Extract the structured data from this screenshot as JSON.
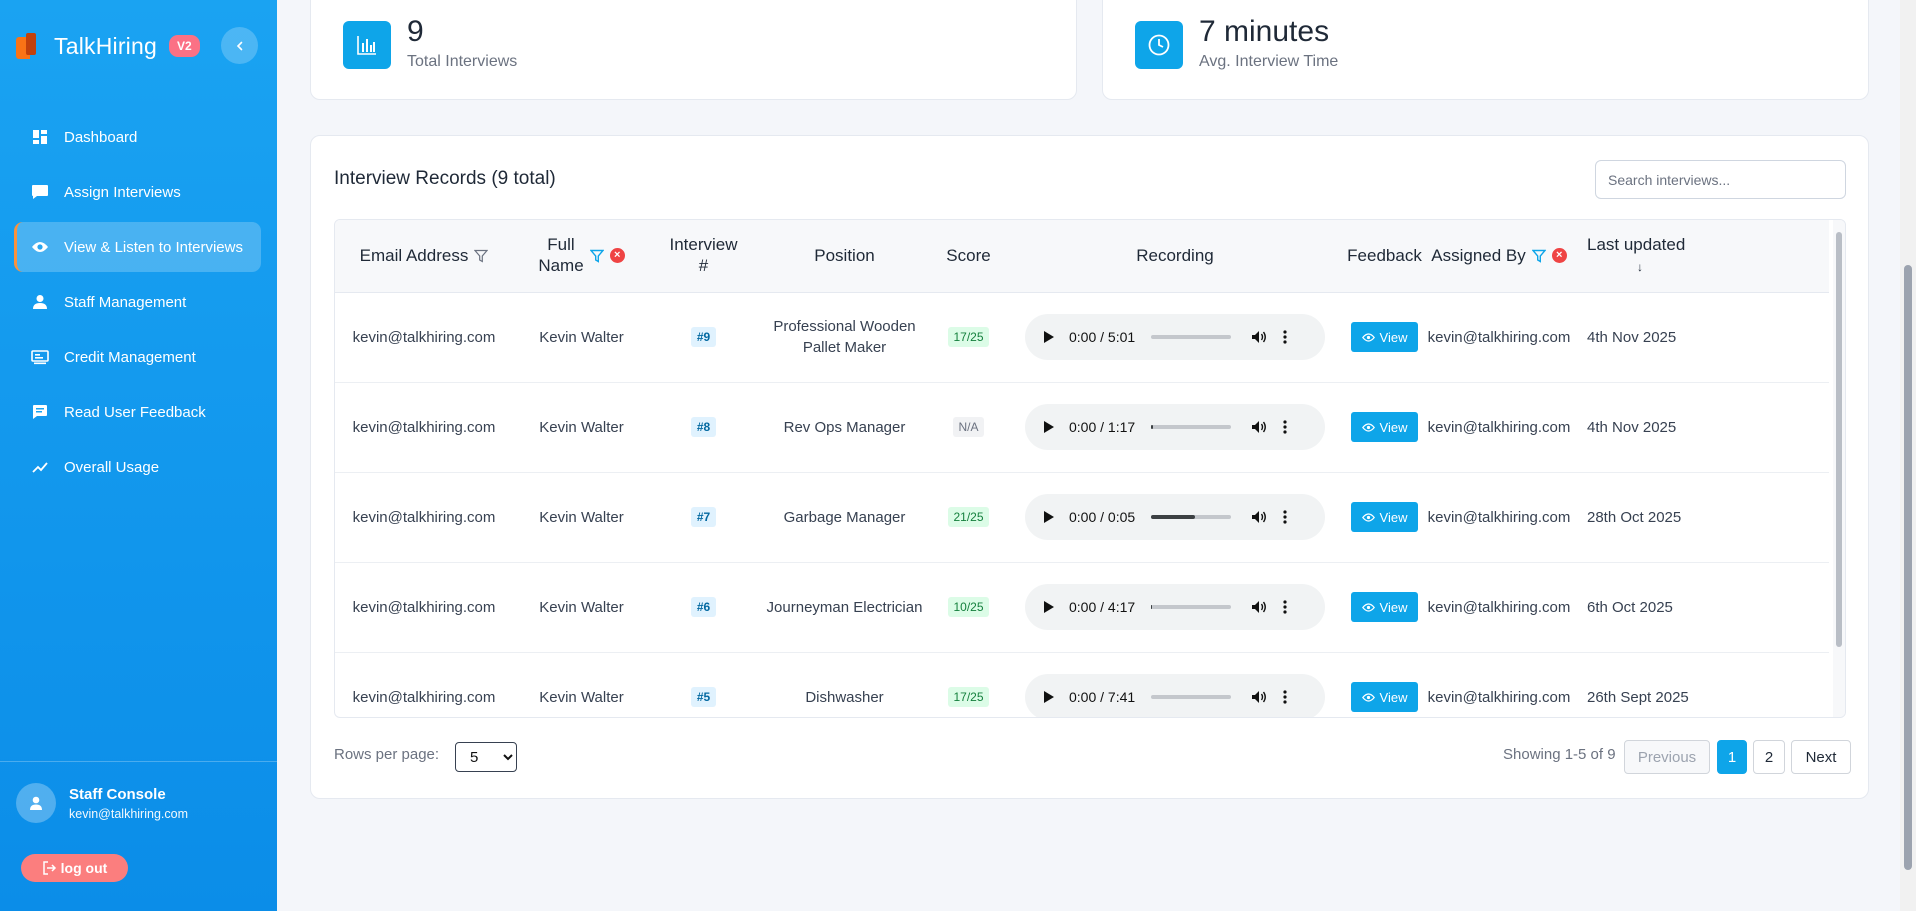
{
  "brand": {
    "name": "TalkHiring",
    "badge": "V2"
  },
  "sidebar": {
    "items": [
      {
        "label": "Dashboard"
      },
      {
        "label": "Assign Interviews"
      },
      {
        "label": "View & Listen to Interviews"
      },
      {
        "label": "Staff Management"
      },
      {
        "label": "Credit Management"
      },
      {
        "label": "Read User Feedback"
      },
      {
        "label": "Overall Usage"
      }
    ],
    "active_index": 2,
    "user": {
      "title": "Staff Console",
      "email": "kevin@talkhiring.com"
    },
    "logout_label": "log out"
  },
  "stats": [
    {
      "value": "9",
      "label": "Total Interviews",
      "icon": "bar-chart-icon"
    },
    {
      "value": "7 minutes",
      "label": "Avg. Interview Time",
      "icon": "clock-icon"
    }
  ],
  "records": {
    "title": "Interview Records (9 total)",
    "search_placeholder": "Search interviews...",
    "columns": {
      "email": "Email Address",
      "name_line1": "Full",
      "name_line2": "Name",
      "num_line1": "Interview",
      "num_line2": "#",
      "position": "Position",
      "score": "Score",
      "recording": "Recording",
      "feedback": "Feedback",
      "assigned": "Assigned By",
      "updated": "Last updated",
      "sort_indicator": "↓"
    },
    "view_label": "View",
    "rows": [
      {
        "email": "kevin@talkhiring.com",
        "name": "Kevin Walter",
        "num": "#9",
        "position": "Professional Wooden Pallet Maker",
        "score": "17/25",
        "time": "0:00 / 5:01",
        "progress": 0.0,
        "assigned": "kevin@talkhiring.com",
        "updated": "4th Nov 2025"
      },
      {
        "email": "kevin@talkhiring.com",
        "name": "Kevin Walter",
        "num": "#8",
        "position": "Rev Ops Manager",
        "score": "N/A",
        "time": "0:00 / 1:17",
        "progress": 0.02,
        "assigned": "kevin@talkhiring.com",
        "updated": "4th Nov 2025"
      },
      {
        "email": "kevin@talkhiring.com",
        "name": "Kevin Walter",
        "num": "#7",
        "position": "Garbage Manager",
        "score": "21/25",
        "time": "0:00 / 0:05",
        "progress": 0.55,
        "assigned": "kevin@talkhiring.com",
        "updated": "28th Oct 2025"
      },
      {
        "email": "kevin@talkhiring.com",
        "name": "Kevin Walter",
        "num": "#6",
        "position": "Journeyman Electrician",
        "score": "10/25",
        "time": "0:00 / 4:17",
        "progress": 0.01,
        "assigned": "kevin@talkhiring.com",
        "updated": "6th Oct 2025"
      },
      {
        "email": "kevin@talkhiring.com",
        "name": "Kevin Walter",
        "num": "#5",
        "position": "Dishwasher",
        "score": "17/25",
        "time": "0:00 / 7:41",
        "progress": 0.0,
        "assigned": "kevin@talkhiring.com",
        "updated": "26th Sept 2025"
      }
    ]
  },
  "pagination": {
    "rows_label": "Rows per page:",
    "rows_value": "5",
    "showing": "Showing 1-5 of 9",
    "previous": "Previous",
    "pages": [
      "1",
      "2"
    ],
    "current_page": "1",
    "next": "Next"
  },
  "colors": {
    "accent": "#0ea5e9",
    "sidebar": "#1aa3f2",
    "badge": "#fb7185",
    "danger": "#ef4444"
  }
}
